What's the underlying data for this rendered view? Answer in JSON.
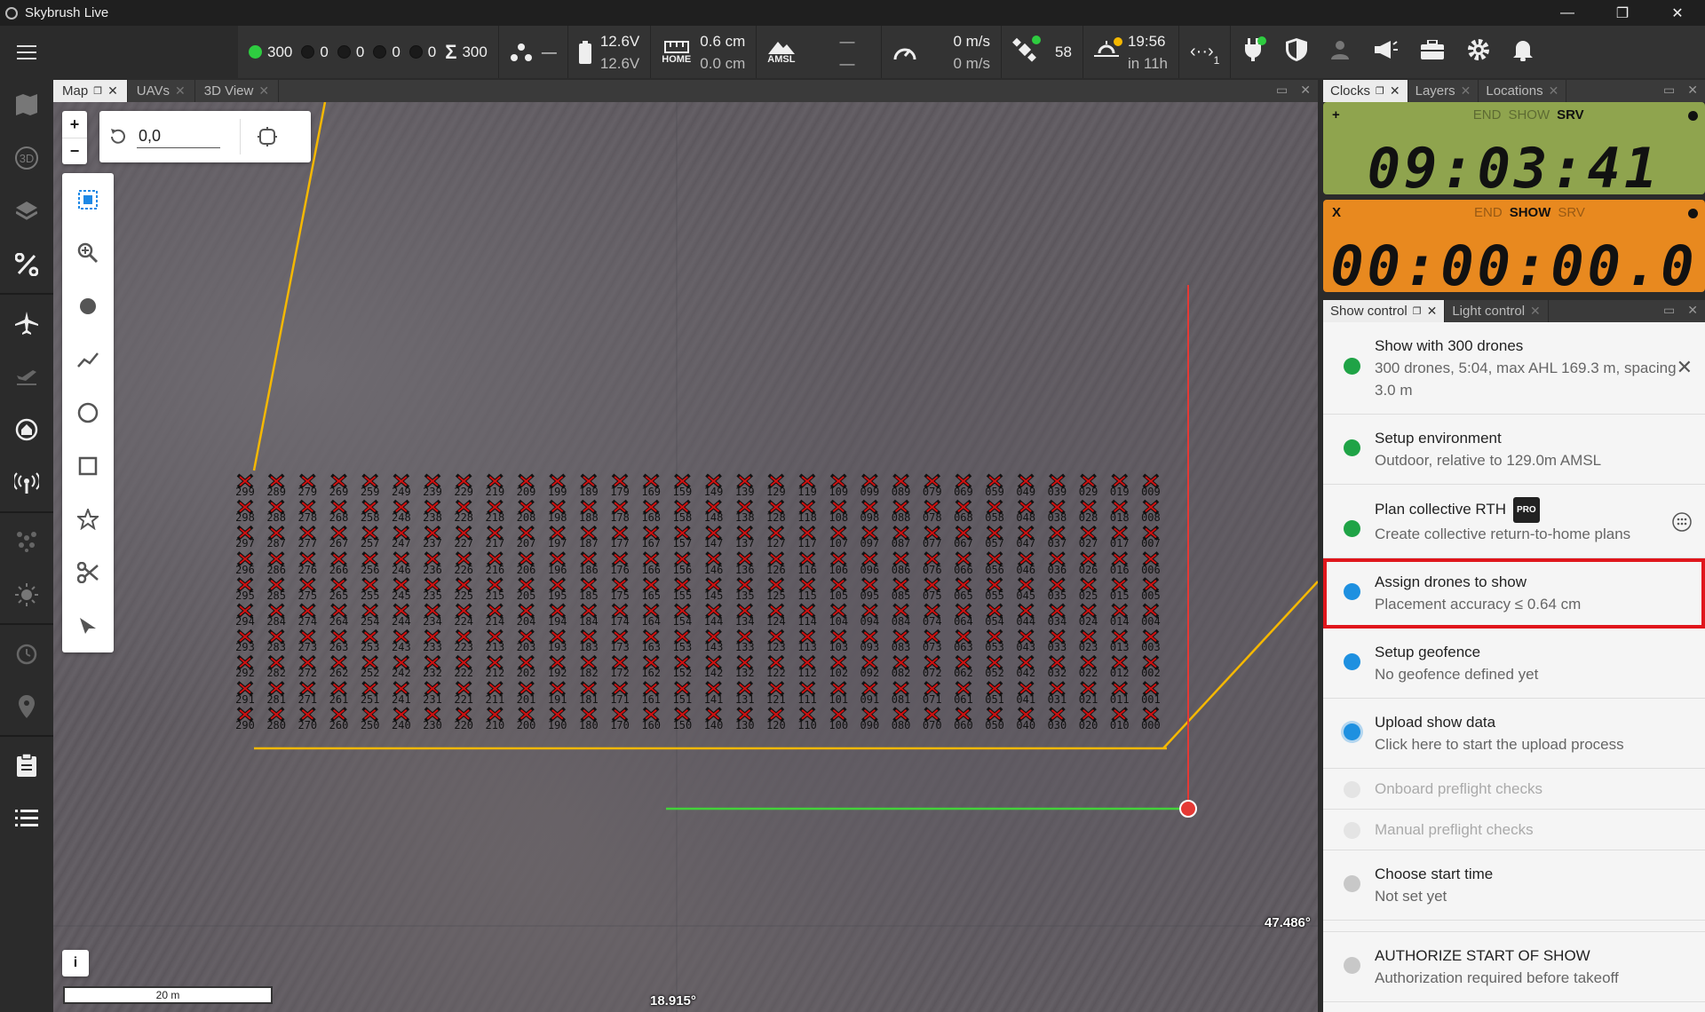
{
  "window": {
    "title": "Skybrush Live",
    "minimize": "—",
    "maximize": "❐",
    "close": "✕"
  },
  "toolbar": {
    "counts": [
      {
        "value": "300",
        "color": "#2ecc40"
      },
      {
        "value": "0",
        "color": "#1a1a1a"
      },
      {
        "value": "0",
        "color": "#1a1a1a"
      },
      {
        "value": "0",
        "color": "#1a1a1a"
      },
      {
        "value": "0",
        "color": "#1a1a1a"
      }
    ],
    "sum_value": "300",
    "selection_value": "—",
    "battery": {
      "top": "12.6V",
      "bottom": "12.6V"
    },
    "home": {
      "top": "0.6 cm",
      "bottom": "0.0 cm",
      "label": "HOME"
    },
    "amsl": {
      "label": "AMSL",
      "top": "—",
      "bottom": "—"
    },
    "speed": {
      "top": "0 m/s",
      "bottom": "0 m/s"
    },
    "gps": {
      "value": "58"
    },
    "sun": {
      "top": "19:56",
      "bottom": "in 11h"
    },
    "network": {
      "value": "1"
    }
  },
  "map_tabs": [
    {
      "label": "Map",
      "active": true
    },
    {
      "label": "UAVs"
    },
    {
      "label": "3D View"
    }
  ],
  "map": {
    "rotation_value": "0,0",
    "scale_label": "20 m",
    "lon_label": "18.915°",
    "lat_label": "47.486°",
    "info": "i",
    "drone_ids": {
      "columns": [
        "29",
        "28",
        "27",
        "26",
        "25",
        "24",
        "23",
        "22",
        "21",
        "20",
        "19",
        "18",
        "17",
        "16",
        "15",
        "14",
        "13",
        "12",
        "11",
        "10",
        "09",
        "08",
        "07",
        "06",
        "05",
        "04",
        "03",
        "02",
        "01",
        "00"
      ],
      "rows": [
        "9",
        "8",
        "7",
        "6",
        "5",
        "4",
        "3",
        "2",
        "1",
        "0"
      ]
    }
  },
  "clock_tabs": [
    {
      "label": "Clocks",
      "active": true
    },
    {
      "label": "Layers"
    },
    {
      "label": "Locations"
    }
  ],
  "clocks": [
    {
      "prefix": "+",
      "modes": [
        "END",
        "SHOW",
        "SRV"
      ],
      "active_mode": "SRV",
      "time": "09:03:41",
      "bg": "#8fa44e"
    },
    {
      "prefix": "X",
      "modes": [
        "END",
        "SHOW",
        "SRV"
      ],
      "active_mode": "SHOW",
      "time": "00:00:00.0",
      "bg": "#e8891f"
    }
  ],
  "show_tabs": [
    {
      "label": "Show control",
      "active": true
    },
    {
      "label": "Light control"
    }
  ],
  "show_steps": [
    {
      "title": "Show with 300 drones",
      "subtitle": "300 drones, 5:04, max AHL 169.3 m, spacing 3.0 m",
      "status": "#1fa346"
    },
    {
      "title": "Setup environment",
      "subtitle": "Outdoor, relative to 129.0m AMSL",
      "status": "#1fa346"
    },
    {
      "title": "Plan collective RTH",
      "badge": "PRO",
      "subtitle": "Create collective return-to-home plans",
      "status": "#1fa346"
    },
    {
      "title": "Assign drones to show",
      "subtitle": "Placement accuracy ≤ 0.64 cm",
      "status": "#1e90e0"
    },
    {
      "title": "Setup geofence",
      "subtitle": "No geofence defined yet",
      "status": "#1e90e0"
    },
    {
      "title": "Upload show data",
      "subtitle": "Click here to start the upload process",
      "status": "#1e90e0"
    },
    {
      "title": "Onboard preflight checks",
      "status": "#e4e4e4"
    },
    {
      "title": "Manual preflight checks",
      "status": "#e4e4e4"
    },
    {
      "title": "Choose start time",
      "subtitle": "Not set yet",
      "status": "#c8c8c8"
    },
    {
      "title": "AUTHORIZE START OF SHOW",
      "subtitle": "Authorization required before takeoff",
      "status": "#c8c8c8"
    }
  ],
  "colors": {
    "accent": "#1e88e5",
    "highlight": "#e0161c",
    "drone": "#d01010",
    "path": "#f5b800"
  }
}
